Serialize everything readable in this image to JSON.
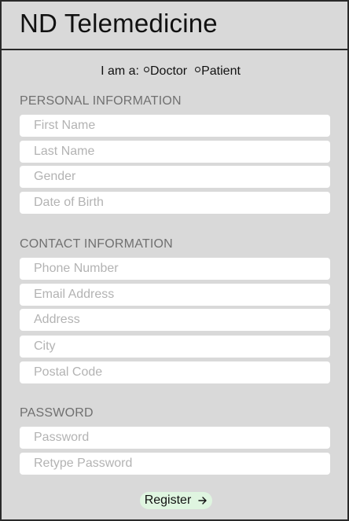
{
  "header": {
    "title": "ND Telemedicine"
  },
  "role": {
    "label": "I am a:",
    "options": [
      {
        "label": "Doctor"
      },
      {
        "label": "Patient"
      }
    ]
  },
  "personal": {
    "title": "PERSONAL INFORMATION",
    "fields": [
      {
        "placeholder": "First Name",
        "value": ""
      },
      {
        "placeholder": "Last Name",
        "value": ""
      },
      {
        "placeholder": "Gender",
        "value": ""
      },
      {
        "placeholder": "Date of Birth",
        "value": ""
      }
    ]
  },
  "contact": {
    "title": "CONTACT INFORMATION",
    "fields": [
      {
        "placeholder": "Phone Number",
        "value": ""
      },
      {
        "placeholder": "Email Address",
        "value": ""
      },
      {
        "placeholder": "Address",
        "value": ""
      },
      {
        "placeholder": "City",
        "value": ""
      },
      {
        "placeholder": "Postal Code",
        "value": ""
      }
    ]
  },
  "password": {
    "title": "PASSWORD",
    "fields": [
      {
        "placeholder": "Password",
        "value": ""
      },
      {
        "placeholder": "Retype Password",
        "value": ""
      }
    ]
  },
  "register": {
    "label": "Register",
    "icon": "arrow-right-icon",
    "color": "#dff5e0"
  }
}
